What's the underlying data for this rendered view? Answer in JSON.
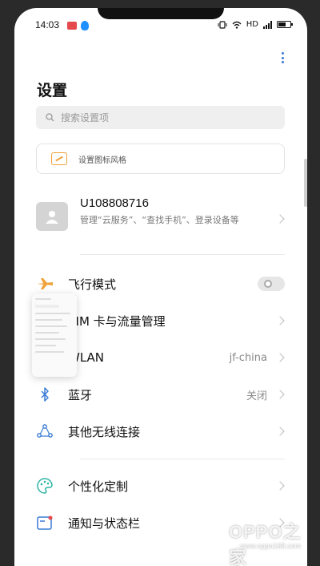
{
  "status_bar": {
    "time": "14:03",
    "network": "HD",
    "colors": {
      "app1": "#e5484d",
      "app2": "#1e90ff"
    }
  },
  "header": {
    "title": "设置",
    "more_icon": "more-vertical-icon"
  },
  "search": {
    "placeholder": "搜索设置项"
  },
  "icon_style_card": {
    "label": "设置图标风格"
  },
  "account": {
    "name": "U108808716",
    "description": "管理“云服务”、“查找手机”、登录设备等"
  },
  "settings": [
    {
      "id": "airplane",
      "label": "飞行模式",
      "icon": "airplane-icon",
      "control": "toggle",
      "toggle_on": false
    },
    {
      "id": "sim",
      "label": "SIM 卡与流量管理",
      "icon": "sim-card-icon"
    },
    {
      "id": "wlan",
      "label": "WLAN",
      "icon": "wifi-icon",
      "value": "jf-china"
    },
    {
      "id": "bluetooth",
      "label": "蓝牙",
      "icon": "bluetooth-icon",
      "value": "关闭"
    },
    {
      "id": "other-wireless",
      "label": "其他无线连接",
      "icon": "connection-icon"
    },
    {
      "id": "personalize",
      "label": "个性化定制",
      "icon": "palette-icon"
    },
    {
      "id": "notifications",
      "label": "通知与状态栏",
      "icon": "notification-icon"
    }
  ],
  "watermark": {
    "brand": "OPPO之家",
    "url": "www.oppo168.com"
  }
}
